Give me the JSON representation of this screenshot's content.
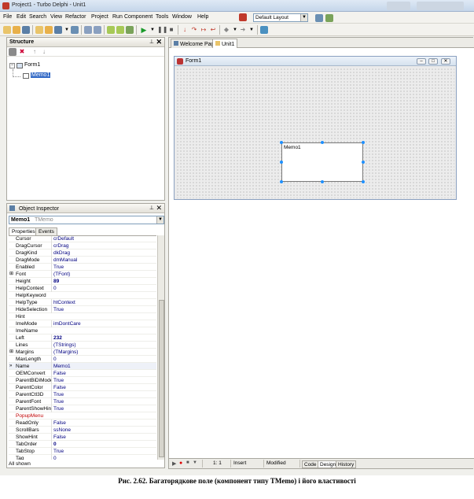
{
  "window": {
    "title": "Project1 - Turbo Delphi - Unit1"
  },
  "menu": [
    "File",
    "Edit",
    "Search",
    "View",
    "Refactor",
    "Project",
    "Run",
    "Component",
    "Tools",
    "Window",
    "Help"
  ],
  "layout_combo": {
    "value": "Default Layout"
  },
  "structure": {
    "title": "Structure",
    "tree": [
      {
        "label": "Form1",
        "level": 0
      },
      {
        "label": "Memo1",
        "level": 1
      }
    ]
  },
  "object_inspector": {
    "title": "Object Inspector",
    "selected_name": "Memo1",
    "selected_type": "TMemo",
    "tabs": [
      "Properties",
      "Events"
    ],
    "footer": "All shown",
    "properties": [
      {
        "name": "Cursor",
        "value": "crDefault"
      },
      {
        "name": "DragCursor",
        "value": "crDrag"
      },
      {
        "name": "DragKind",
        "value": "dkDrag"
      },
      {
        "name": "DragMode",
        "value": "dmManual"
      },
      {
        "name": "Enabled",
        "value": "True"
      },
      {
        "name": "Font",
        "value": "(TFont)",
        "expand": "⊞"
      },
      {
        "name": "Height",
        "value": "89",
        "bold": true
      },
      {
        "name": "HelpContext",
        "value": "0"
      },
      {
        "name": "HelpKeyword",
        "value": ""
      },
      {
        "name": "HelpType",
        "value": "htContext"
      },
      {
        "name": "HideSelection",
        "value": "True"
      },
      {
        "name": "Hint",
        "value": ""
      },
      {
        "name": "ImeMode",
        "value": "imDontCare"
      },
      {
        "name": "ImeName",
        "value": ""
      },
      {
        "name": "Left",
        "value": "232",
        "bold": true
      },
      {
        "name": "Lines",
        "value": "(TStrings)"
      },
      {
        "name": "Margins",
        "value": "(TMargins)",
        "expand": "⊞"
      },
      {
        "name": "MaxLength",
        "value": "0"
      },
      {
        "name": "Name",
        "value": "Memo1",
        "marker": "»",
        "selected": true
      },
      {
        "name": "OEMConvert",
        "value": "False"
      },
      {
        "name": "ParentBiDiMode",
        "value": "True"
      },
      {
        "name": "ParentColor",
        "value": "False"
      },
      {
        "name": "ParentCtl3D",
        "value": "True"
      },
      {
        "name": "ParentFont",
        "value": "True"
      },
      {
        "name": "ParentShowHint",
        "value": "True"
      },
      {
        "name": "PopupMenu",
        "value": "",
        "red": true
      },
      {
        "name": "ReadOnly",
        "value": "False"
      },
      {
        "name": "ScrollBars",
        "value": "ssNone"
      },
      {
        "name": "ShowHint",
        "value": "False"
      },
      {
        "name": "TabOrder",
        "value": "0",
        "bold": true
      },
      {
        "name": "TabStop",
        "value": "True"
      },
      {
        "name": "Tag",
        "value": "0"
      }
    ]
  },
  "designer": {
    "tabs": [
      "Welcome Page",
      "Unit1"
    ],
    "form_title": "Form1",
    "memo_text": "Memo1",
    "status": {
      "position": "1:   1",
      "mode": "Insert",
      "state": "Modified"
    },
    "bottom_tabs": [
      "Code",
      "Design",
      "History"
    ]
  },
  "caption": "Рис. 2.62. Багаторядкове поле (компонент типу TMemo) і його властивості"
}
